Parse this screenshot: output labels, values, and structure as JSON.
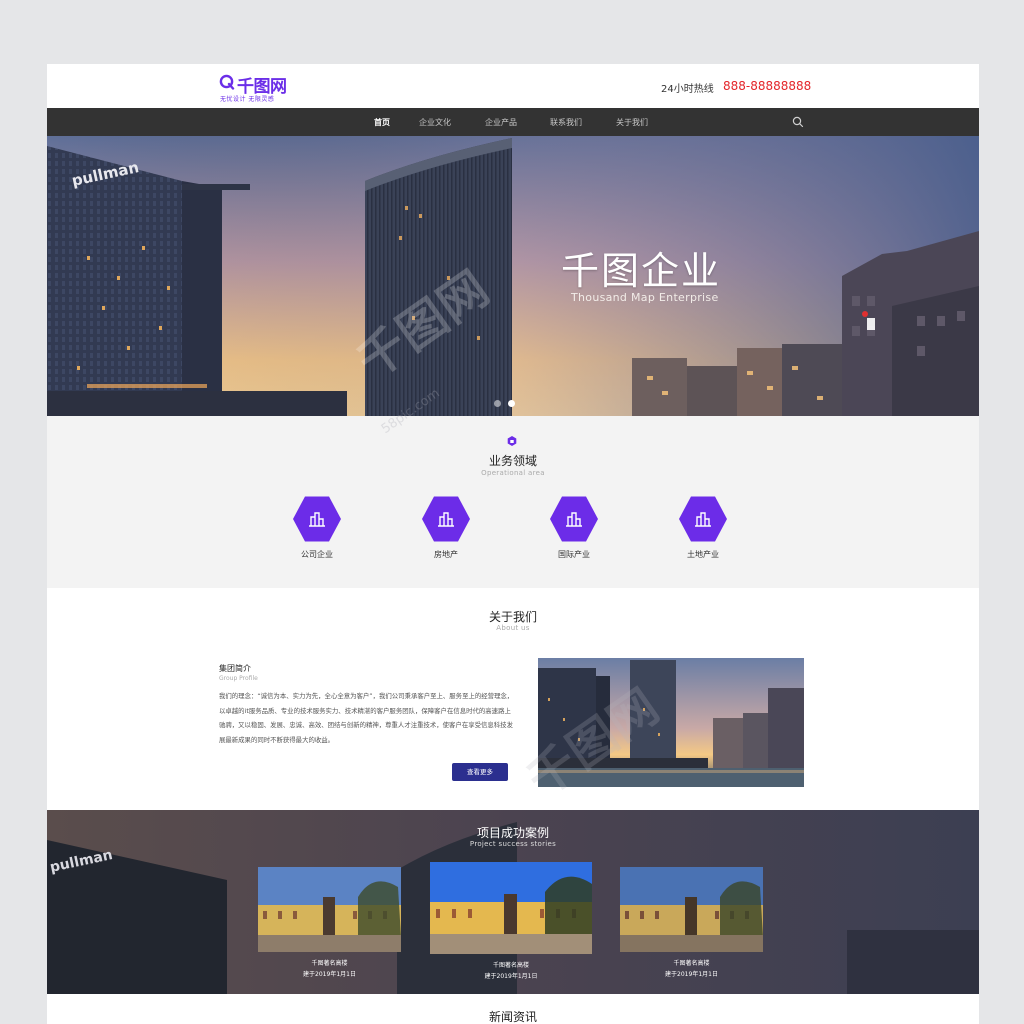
{
  "header": {
    "logo_name": "千图网",
    "logo_slogan": "无忧设计  无限灵感",
    "hotline_label": "24小时热线",
    "hotline_number": "888-88888888"
  },
  "nav": {
    "items": [
      {
        "label": "首页",
        "active": true
      },
      {
        "label": "企业文化"
      },
      {
        "label": "企业产品"
      },
      {
        "label": "联系我们"
      },
      {
        "label": "关于我们"
      }
    ]
  },
  "hero": {
    "title": "千图企业",
    "subtitle": "Thousand Map Enterprise",
    "building_sign": "pullman",
    "slides_total": 2,
    "active_slide": 2
  },
  "business": {
    "title": "业务领域",
    "subtitle": "Operational area",
    "items": [
      {
        "label": "公司企业"
      },
      {
        "label": "房地产"
      },
      {
        "label": "国际产业"
      },
      {
        "label": "土地产业"
      }
    ]
  },
  "about": {
    "title": "关于我们",
    "subtitle": "About us",
    "group_title": "集团简介",
    "group_subtitle": "Group Profile",
    "text": "我们的理念：“诚信为本、实力为先，全心全意为客户”，我们公司秉承客户至上、服务至上的经营理念，以卓越的it服务品质、专业的技术服务实力、技术精湛的客户服务团队，保障客户在信息时代的高速路上驰骋，又以稳固、发展、忠诚、高效、团结与创新的精神，尊重人才注重技术，使客户在享受信息科技发展最新成果的同时不断获得最大的收益。",
    "more_button": "查看更多"
  },
  "cases": {
    "title": "项目成功案例",
    "subtitle": "Project success stories",
    "items": [
      {
        "name": "千图著名高楼",
        "date": "建于2019年1月1日"
      },
      {
        "name": "千图著名高楼",
        "date": "建于2019年1月1日"
      },
      {
        "name": "千图著名高楼",
        "date": "建于2019年1月1日"
      }
    ]
  },
  "news": {
    "title": "新闻资讯"
  },
  "watermark": {
    "text": "千图网",
    "url": "58pic.com"
  },
  "colors": {
    "brand_purple": "#6c2ce8",
    "nav_bg": "#333333",
    "hotline_red": "#e4262b",
    "button_blue": "#2b2f8f"
  },
  "icons": {
    "logo": "q-logo-icon",
    "search": "search-icon",
    "section": "hexagon-badge-icon",
    "business": "buildings-icon"
  }
}
